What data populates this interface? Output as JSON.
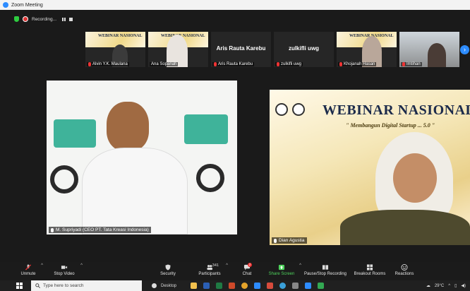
{
  "window": {
    "title": "Zoom Meeting"
  },
  "recording": {
    "label": "Recording..."
  },
  "thumbnails": [
    {
      "name": "Alvin Y.K. Maulana",
      "banner": "WEBINAR NASIONAL",
      "muted": true
    },
    {
      "name": "Ana Sopanah",
      "banner": "WEBINAR NASIONAL",
      "muted": false
    },
    {
      "name": "Aris Rauta Karebu",
      "display": "Aris Rauta Karebu",
      "muted": true
    },
    {
      "name": "zulkifli uwg",
      "display": "zulkifli uwg",
      "muted": true
    },
    {
      "name": "Khojanah Hasan",
      "banner": "WEBINAR NASIONAL",
      "muted": true
    },
    {
      "name": "Imtihan",
      "muted": true
    }
  ],
  "speakers": {
    "left": {
      "name": "M. Supriyadi (CEO PT. Tata Kreasi Indonesia)"
    },
    "right": {
      "name": "Dian Agustia",
      "slide_title": "WEBINAR NASIONAL",
      "slide_subtitle": "\" Membangun Digital Startup ... 5.0 \""
    }
  },
  "toolbar": {
    "unmute": "Unmute",
    "stop_video": "Stop Video",
    "security": "Security",
    "participants": "Participants",
    "participants_count": "341",
    "chat": "Chat",
    "chat_badge": "2",
    "share_screen": "Share Screen",
    "record": "Pause/Stop Recording",
    "breakout": "Breakout Rooms",
    "reactions": "Reactions"
  },
  "taskbar": {
    "search_placeholder": "Type here to search",
    "desktop": "Desktop",
    "temperature": "29°C"
  },
  "colors": {
    "accent": "#2d8cff",
    "share_green": "#4ed35c",
    "muted_red": "#e33333"
  }
}
